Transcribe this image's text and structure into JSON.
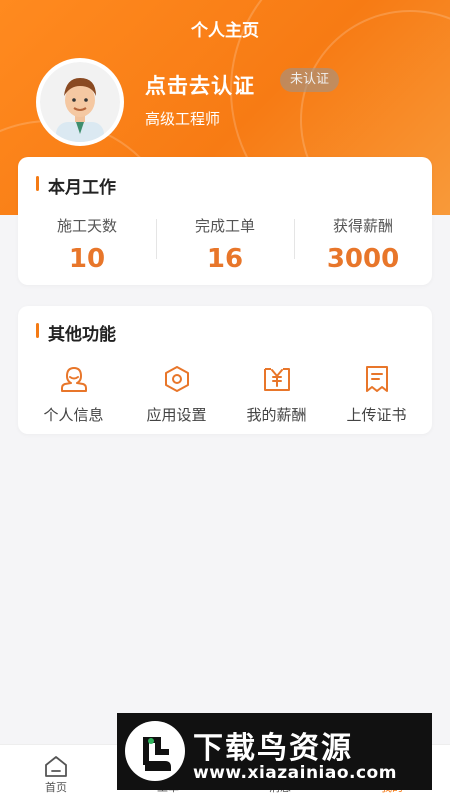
{
  "header": {
    "title": "个人主页"
  },
  "profile": {
    "name": "点击去认证",
    "badge": "未认证",
    "role": "高级工程师"
  },
  "monthly": {
    "title": "本月工作",
    "stats": [
      {
        "label": "施工天数",
        "value": "10"
      },
      {
        "label": "完成工单",
        "value": "16"
      },
      {
        "label": "获得薪酬",
        "value": "3000"
      }
    ]
  },
  "functions": {
    "title": "其他功能",
    "items": [
      {
        "label": "个人信息",
        "icon": "user-icon"
      },
      {
        "label": "应用设置",
        "icon": "settings-icon"
      },
      {
        "label": "我的薪酬",
        "icon": "salary-icon"
      },
      {
        "label": "上传证书",
        "icon": "certificate-icon"
      }
    ]
  },
  "tabbar": {
    "items": [
      {
        "label": "首页",
        "icon": "home-icon"
      },
      {
        "label": "工单",
        "icon": "order-icon"
      },
      {
        "label": "消息",
        "icon": "message-icon"
      },
      {
        "label": "我的",
        "icon": "profile-icon"
      }
    ],
    "active": "我的"
  },
  "watermark": {
    "title": "下载鸟资源",
    "url": "www.xiazainiao.com"
  },
  "colors": {
    "accent": "#f47a14",
    "value": "#e8762a",
    "background": "#f5f5f7"
  }
}
